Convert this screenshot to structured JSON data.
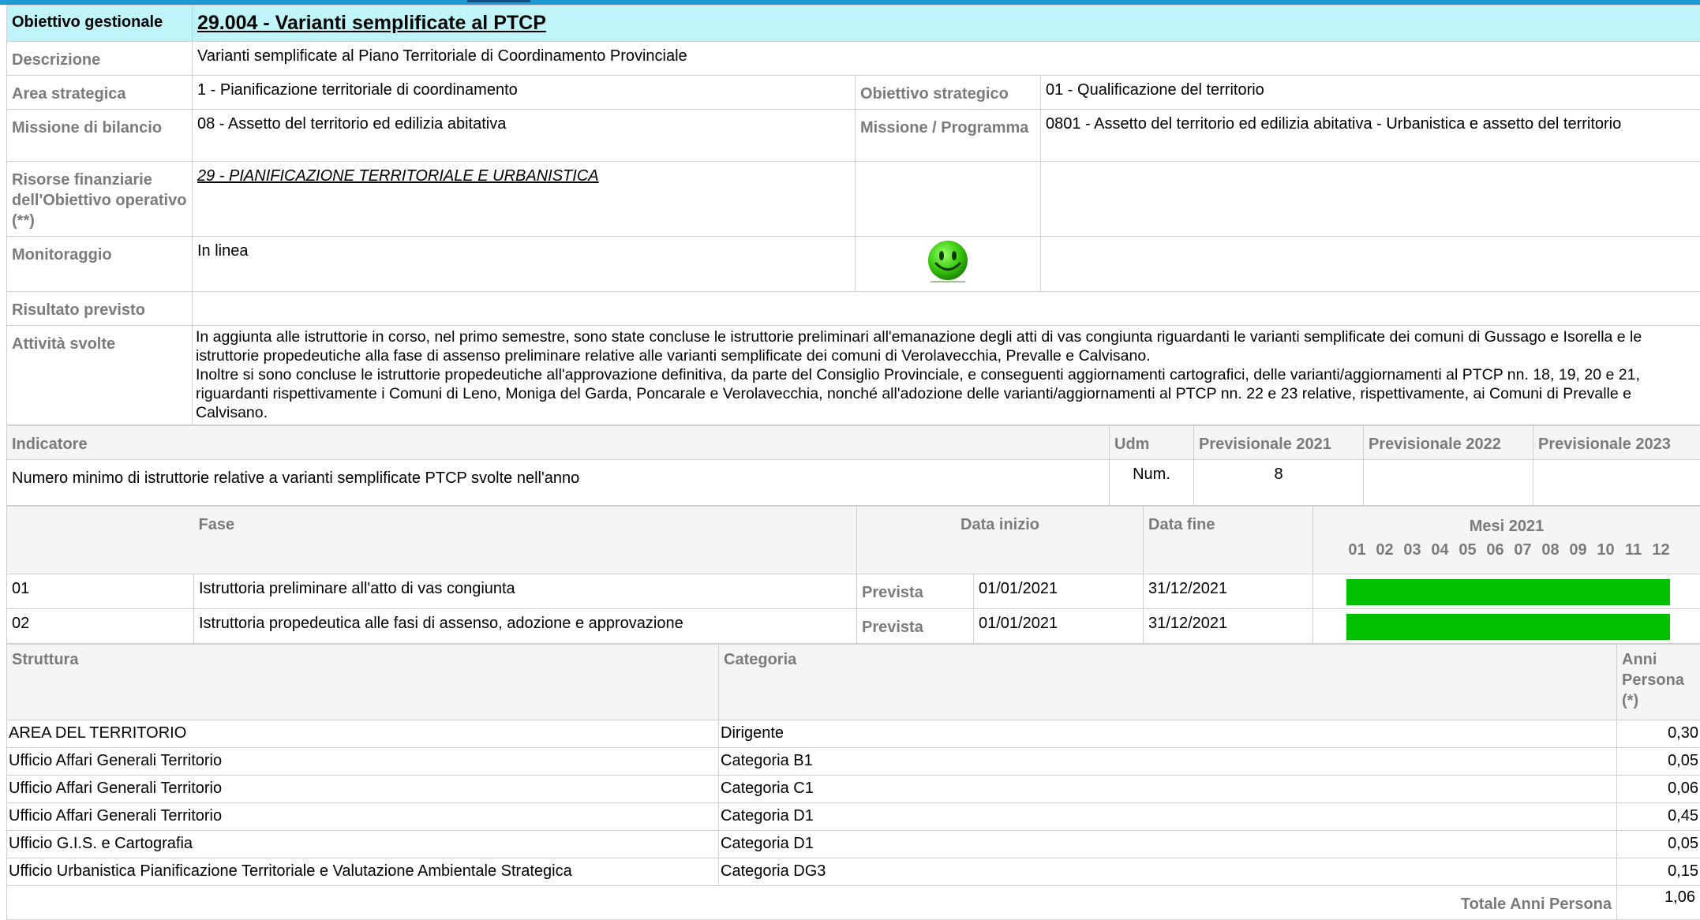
{
  "objective": {
    "label": "Obiettivo gestionale",
    "title": "29.004 - Varianti semplificate al PTCP"
  },
  "rows": {
    "descrizione": {
      "label": "Descrizione",
      "value": "Varianti semplificate al Piano Territoriale di Coordinamento Provinciale"
    },
    "area": {
      "label": "Area strategica",
      "value": "1 - Pianificazione territoriale di coordinamento",
      "label2": "Obiettivo strategico",
      "value2": "01 - Qualificazione del territorio"
    },
    "missione": {
      "label": "Missione di bilancio",
      "value": "08 - Assetto del territorio ed edilizia abitativa",
      "label2": "Missione / Programma",
      "value2": "0801 - Assetto del territorio ed edilizia abitativa - Urbanistica e assetto del territorio"
    },
    "risorse": {
      "label": "Risorse finanziarie dell'Obiettivo operativo (**)",
      "value": "29 - PIANIFICAZIONE TERRITORIALE E URBANISTICA"
    },
    "monitoraggio": {
      "label": "Monitoraggio",
      "value": "In linea"
    },
    "risultato": {
      "label": "Risultato previsto",
      "value": ""
    },
    "attivita": {
      "label": "Attività svolte",
      "p1": "In aggiunta alle istruttorie in corso, nel primo semestre, sono state concluse le istruttorie preliminari all'emanazione degli atti di vas congiunta riguardanti le varianti semplificate dei comuni di Gussago e Isorella e le istruttorie propedeutiche alla fase di assenso preliminare relative alle varianti semplificate dei comuni di Verolavecchia, Prevalle e Calvisano.",
      "p2": "Inoltre si sono concluse le istruttorie propedeutiche all'approvazione definitiva, da parte del Consiglio Provinciale, e conseguenti aggiornamenti cartografici, delle varianti/aggiornamenti al PTCP nn. 18, 19, 20 e 21, riguardanti rispettivamente i Comuni di Leno, Moniga del Garda, Poncarale e Verolavecchia, nonché all'adozione delle varianti/aggiornamenti al PTCP nn. 22 e 23 relative, rispettivamente, ai Comuni di Prevalle e Calvisano."
    }
  },
  "indicatori": {
    "headers": {
      "indicatore": "Indicatore",
      "udm": "Udm",
      "p2021": "Previsionale 2021",
      "p2022": "Previsionale 2022",
      "p2023": "Previsionale 2023"
    },
    "row": {
      "indicatore": "Numero minimo di istruttorie relative a varianti semplificate PTCP svolte nell'anno",
      "udm": "Num.",
      "p2021": "8",
      "p2022": "",
      "p2023": ""
    }
  },
  "fasi": {
    "headers": {
      "fase": "Fase",
      "inizio": "Data inizio",
      "fine": "Data fine",
      "mesi": "Mesi 2021"
    },
    "months": [
      "01",
      "02",
      "03",
      "04",
      "05",
      "06",
      "07",
      "08",
      "09",
      "10",
      "11",
      "12"
    ],
    "bar_color": "#00c000",
    "items": [
      {
        "num": "01",
        "desc": "Istruttoria preliminare all'atto di vas congiunta",
        "stato": "Prevista",
        "inizio": "01/01/2021",
        "fine": "31/12/2021",
        "fill": 1.0
      },
      {
        "num": "02",
        "desc": "Istruttoria propedeutica alle fasi di assenso, adozione e approvazione",
        "stato": "Prevista",
        "inizio": "01/01/2021",
        "fine": "31/12/2021",
        "fill": 1.0
      }
    ]
  },
  "struttura": {
    "headers": {
      "struttura": "Struttura",
      "categoria": "Categoria",
      "anni": "Anni Persona (*)"
    },
    "rows": [
      {
        "struttura": "AREA DEL TERRITORIO",
        "categoria": "Dirigente",
        "anni": "0,30"
      },
      {
        "struttura": "Ufficio Affari Generali Territorio",
        "categoria": "Categoria B1",
        "anni": "0,05"
      },
      {
        "struttura": "Ufficio Affari Generali Territorio",
        "categoria": "Categoria C1",
        "anni": "0,06"
      },
      {
        "struttura": "Ufficio Affari Generali Territorio",
        "categoria": "Categoria D1",
        "anni": "0,45"
      },
      {
        "struttura": "Ufficio G.I.S. e Cartografia",
        "categoria": "Categoria D1",
        "anni": "0,05"
      },
      {
        "struttura": "Ufficio Urbanistica Pianificazione Territoriale e Valutazione Ambientale Strategica",
        "categoria": "Categoria DG3",
        "anni": "0,15"
      }
    ],
    "totale_label": "Totale Anni Persona",
    "totale": "1,06"
  },
  "colors": {
    "header_bg": "#bff5f8",
    "accent": "#1e9ad6",
    "label": "#7b7b7b",
    "status_green": "#00c000"
  }
}
